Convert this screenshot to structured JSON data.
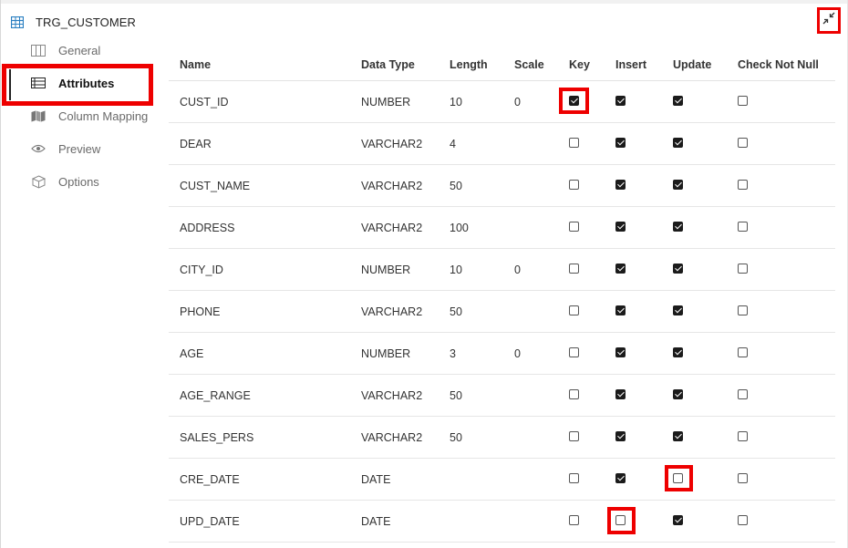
{
  "header": {
    "title": "TRG_CUSTOMER",
    "icon": "table-grid-icon",
    "collapse_icon": "collapse-arrows-icon"
  },
  "sidebar": {
    "items": [
      {
        "label": "General",
        "icon": "columns-icon",
        "active": false
      },
      {
        "label": "Attributes",
        "icon": "list-table-icon",
        "active": true
      },
      {
        "label": "Column Mapping",
        "icon": "map-icon",
        "active": false
      },
      {
        "label": "Preview",
        "icon": "eye-icon",
        "active": false
      },
      {
        "label": "Options",
        "icon": "cube-icon",
        "active": false
      }
    ]
  },
  "table": {
    "headers": [
      "Name",
      "Data Type",
      "Length",
      "Scale",
      "Key",
      "Insert",
      "Update",
      "Check Not Null"
    ],
    "rows": [
      {
        "name": "CUST_ID",
        "type": "NUMBER",
        "length": "10",
        "scale": "0",
        "key": true,
        "insert": true,
        "update": true,
        "not_null": false
      },
      {
        "name": "DEAR",
        "type": "VARCHAR2",
        "length": "4",
        "scale": "",
        "key": false,
        "insert": true,
        "update": true,
        "not_null": false
      },
      {
        "name": "CUST_NAME",
        "type": "VARCHAR2",
        "length": "50",
        "scale": "",
        "key": false,
        "insert": true,
        "update": true,
        "not_null": false
      },
      {
        "name": "ADDRESS",
        "type": "VARCHAR2",
        "length": "100",
        "scale": "",
        "key": false,
        "insert": true,
        "update": true,
        "not_null": false
      },
      {
        "name": "CITY_ID",
        "type": "NUMBER",
        "length": "10",
        "scale": "0",
        "key": false,
        "insert": true,
        "update": true,
        "not_null": false
      },
      {
        "name": "PHONE",
        "type": "VARCHAR2",
        "length": "50",
        "scale": "",
        "key": false,
        "insert": true,
        "update": true,
        "not_null": false
      },
      {
        "name": "AGE",
        "type": "NUMBER",
        "length": "3",
        "scale": "0",
        "key": false,
        "insert": true,
        "update": true,
        "not_null": false
      },
      {
        "name": "AGE_RANGE",
        "type": "VARCHAR2",
        "length": "50",
        "scale": "",
        "key": false,
        "insert": true,
        "update": true,
        "not_null": false
      },
      {
        "name": "SALES_PERS",
        "type": "VARCHAR2",
        "length": "50",
        "scale": "",
        "key": false,
        "insert": true,
        "update": true,
        "not_null": false
      },
      {
        "name": "CRE_DATE",
        "type": "DATE",
        "length": "",
        "scale": "",
        "key": false,
        "insert": true,
        "update": false,
        "not_null": false
      },
      {
        "name": "UPD_DATE",
        "type": "DATE",
        "length": "",
        "scale": "",
        "key": false,
        "insert": false,
        "update": true,
        "not_null": false
      }
    ]
  },
  "colors": {
    "highlight": "#e00000",
    "checkbox_checked": "#1b1b1b"
  }
}
